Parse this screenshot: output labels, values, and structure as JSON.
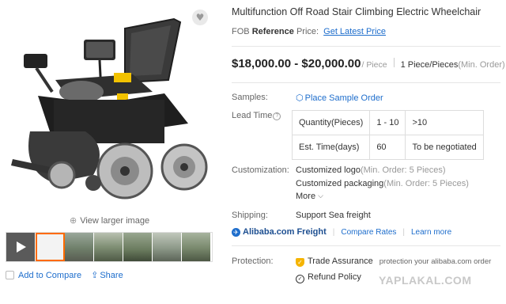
{
  "product": {
    "title": "Multifunction Off Road Stair Climbing Electric Wheelchair",
    "fob_prefix": "FOB",
    "fob_reference": "Reference",
    "fob_price_label": "Price:",
    "fob_link": "Get Latest Price",
    "price_range": "$18,000.00 - $20,000.00",
    "price_unit": "/ Piece",
    "moq_value": "1 Piece/Pieces",
    "moq_note": "(Min. Order)"
  },
  "gallery": {
    "view_larger": "View larger image",
    "thumbnails": [
      "video",
      "wheelchair",
      "scene-1",
      "scene-2",
      "scene-3",
      "scene-4",
      "scene-5"
    ]
  },
  "left_actions": {
    "add_to_compare": "Add to Compare",
    "share": "Share"
  },
  "samples": {
    "label": "Samples:",
    "link": "Place Sample Order"
  },
  "lead_time": {
    "label": "Lead Time",
    "rows": [
      [
        "Quantity(Pieces)",
        "1 - 10",
        ">10"
      ],
      [
        "Est. Time(days)",
        "60",
        "To be negotiated"
      ]
    ]
  },
  "customization": {
    "label": "Customization:",
    "items": [
      {
        "name": "Customized logo",
        "note": "(Min. Order: 5 Pieces)"
      },
      {
        "name": "Customized packaging",
        "note": "(Min. Order: 5 Pieces)"
      }
    ],
    "more": "More"
  },
  "shipping": {
    "label": "Shipping:",
    "value": "Support Sea freight",
    "freight_name": "Alibaba.com Freight",
    "compare_rates": "Compare Rates",
    "learn_more": "Learn more"
  },
  "protection": {
    "label": "Protection:",
    "trade_assurance": "Trade Assurance",
    "trade_note": "protection your alibaba.com order",
    "refund_policy": "Refund Policy"
  },
  "watermark": "YAPLAKAL.COM",
  "colors": {
    "link_blue": "#1d6dcc",
    "accent_orange": "#ff6a00",
    "trade_assurance_yellow": "#f5b400"
  }
}
